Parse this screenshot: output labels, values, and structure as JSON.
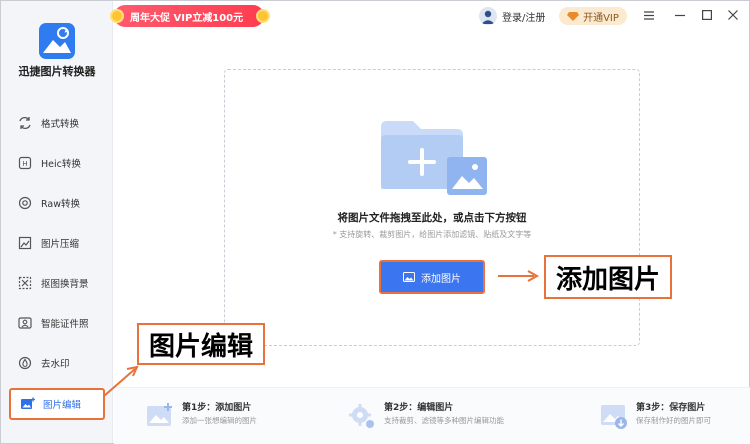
{
  "app": {
    "name": "迅捷图片转换器",
    "colors": {
      "accent": "#3b76f0",
      "annotation": "#e9713a",
      "promo": "#ff4456",
      "vip": "#8a5a22"
    }
  },
  "topbar": {
    "promo": "周年大促 VIP立减100元",
    "login": "登录/注册",
    "vip": "开通VIP",
    "window_controls": [
      "menu-icon",
      "minimize-icon",
      "maximize-icon",
      "close-icon"
    ]
  },
  "sidebar": {
    "items": [
      {
        "label": "格式转换",
        "icon": "format-convert-icon"
      },
      {
        "label": "Heic转换",
        "icon": "heic-icon"
      },
      {
        "label": "Raw转换",
        "icon": "raw-icon"
      },
      {
        "label": "图片压缩",
        "icon": "compress-icon"
      },
      {
        "label": "抠图换背景",
        "icon": "cutout-icon"
      },
      {
        "label": "智能证件照",
        "icon": "id-photo-icon"
      },
      {
        "label": "去水印",
        "icon": "watermark-icon"
      },
      {
        "label": "图片编辑",
        "icon": "image-edit-icon",
        "active": true
      }
    ]
  },
  "main": {
    "drop_title": "将图片文件拖拽至此处，或点击下方按钮",
    "drop_hint": "* 支持旋转、裁剪图片，给图片添加滤镜、贴纸及文字等",
    "add_button": "添加图片"
  },
  "annotations": {
    "add_image": "添加图片",
    "image_edit": "图片编辑"
  },
  "steps": [
    {
      "title": "第1步：添加图片",
      "desc": "添加一张想编辑的图片"
    },
    {
      "title": "第2步：编辑图片",
      "desc": "支持裁剪、滤镜等多种图片编辑功能"
    },
    {
      "title": "第3步：保存图片",
      "desc": "保存制作好的图片即可"
    }
  ]
}
